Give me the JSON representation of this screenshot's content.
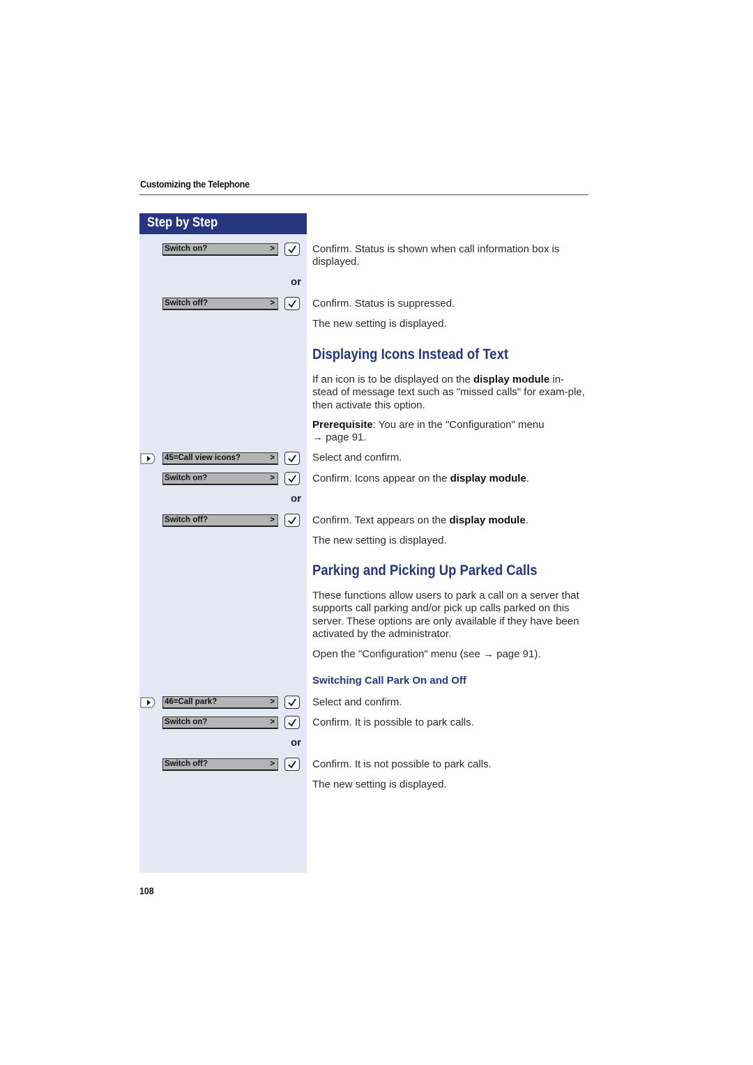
{
  "header": {
    "section_title": "Customizing the Telephone"
  },
  "sidebar": {
    "title": "Step by Step"
  },
  "steps": [
    {
      "nav": false,
      "display": "Switch on?",
      "arrow": ">",
      "description_html": "Confirm. Status is shown when call information box is displayed."
    },
    {
      "or": "or"
    },
    {
      "nav": false,
      "display": "Switch off?",
      "arrow": ">",
      "description_html": "Confirm. Status is suppressed."
    },
    {
      "note": "The new setting is displayed."
    }
  ],
  "section1": {
    "title": "Displaying Icons Instead of Text",
    "intro_pre": "If an icon is to be displayed on the ",
    "intro_bold": "display module",
    "intro_post": " in-stead of message text such as \"missed calls\" for exam-ple, then activate this option.",
    "prereq_label": "Prerequisite",
    "prereq_text": ": You are in the \"Configuration\" menu",
    "prereq_ref": "→ page 91.",
    "steps": [
      {
        "nav": true,
        "display": "45=Call view icons?",
        "arrow": ">",
        "desc": "Select and confirm."
      },
      {
        "nav": false,
        "display": "Switch on?",
        "arrow": ">",
        "desc_pre": "Confirm. Icons appear on the ",
        "desc_bold": "display module",
        "desc_post": "."
      },
      {
        "or": "or"
      },
      {
        "nav": false,
        "display": "Switch off?",
        "arrow": ">",
        "desc_pre": "Confirm. Text appears on the ",
        "desc_bold": "display module",
        "desc_post": "."
      }
    ],
    "note": "The new setting is displayed."
  },
  "section2": {
    "title": "Parking and Picking Up Parked Calls",
    "intro": "These functions allow users to park a call on a server that supports call parking and/or pick up calls parked on this server. These options are only available if they have been activated by the administrator.",
    "open_menu": "Open the \"Configuration\" menu (see → page 91).",
    "subtitle": "Switching Call Park On and Off",
    "steps": [
      {
        "nav": true,
        "display": "46=Call park?",
        "arrow": ">",
        "desc": "Select and confirm."
      },
      {
        "nav": false,
        "display": "Switch on?",
        "arrow": ">",
        "desc": "Confirm. It is possible to park calls."
      },
      {
        "or": "or"
      },
      {
        "nav": false,
        "display": "Switch off?",
        "arrow": ">",
        "desc": "Confirm. It is not possible to park calls."
      }
    ],
    "note": "The new setting is displayed."
  },
  "footer": {
    "page_number": "108"
  },
  "colors": {
    "accent": "#27377f",
    "sidebar_bg": "#e3e8f3",
    "display_bg": "#b4b4b4"
  }
}
